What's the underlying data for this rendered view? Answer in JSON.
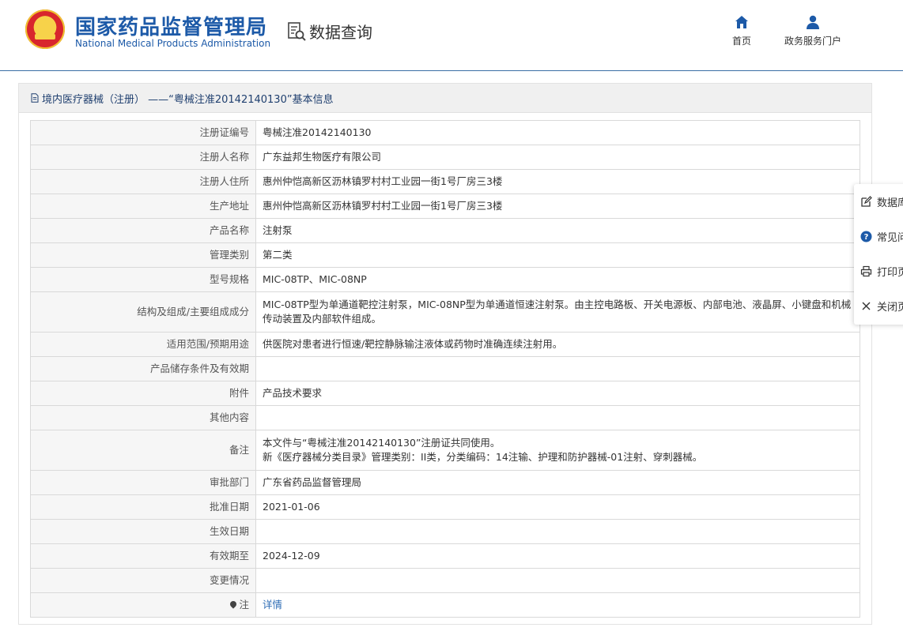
{
  "header": {
    "org_name_cn": "国家药品监督管理局",
    "org_name_en": "National Medical Products Administration",
    "query_title": "数据查询",
    "nav": [
      {
        "label": "首页",
        "icon": "home-icon"
      },
      {
        "label": "政务服务门户",
        "icon": "user-icon"
      }
    ]
  },
  "panel": {
    "title": "境内医疗器械（注册） ——“粤械注准20142140130”基本信息"
  },
  "rows": [
    {
      "label": "注册证编号",
      "value": "粤械注准20142140130"
    },
    {
      "label": "注册人名称",
      "value": "广东益邦生物医疗有限公司"
    },
    {
      "label": "注册人住所",
      "value": "惠州仲恺高新区沥林镇罗村村工业园一街1号厂房三3楼"
    },
    {
      "label": "生产地址",
      "value": "惠州仲恺高新区沥林镇罗村村工业园一街1号厂房三3楼"
    },
    {
      "label": "产品名称",
      "value": "注射泵"
    },
    {
      "label": "管理类别",
      "value": "第二类"
    },
    {
      "label": "型号规格",
      "value": "MIC-08TP、MIC-08NP"
    },
    {
      "label": "结构及组成/主要组成成分",
      "value": "MIC-08TP型为单通道靶控注射泵，MIC-08NP型为单通道恒速注射泵。由主控电路板、开关电源板、内部电池、液晶屏、小键盘和机械传动装置及内部软件组成。"
    },
    {
      "label": "适用范围/预期用途",
      "value": "供医院对患者进行恒速/靶控静脉输注液体或药物时准确连续注射用。"
    },
    {
      "label": "产品储存条件及有效期",
      "value": ""
    },
    {
      "label": "附件",
      "value": "产品技术要求"
    },
    {
      "label": "其他内容",
      "value": ""
    },
    {
      "label": "备注",
      "value_line1": "本文件与“粤械注准20142140130”注册证共同使用。",
      "value_line2": "新《医疗器械分类目录》管理类别：II类，分类编码：14注输、护理和防护器械-01注射、穿刺器械。"
    },
    {
      "label": "审批部门",
      "value": "广东省药品监督管理局"
    },
    {
      "label": "批准日期",
      "value": "2021-01-06"
    },
    {
      "label": "生效日期",
      "value": ""
    },
    {
      "label": "有效期至",
      "value": "2024-12-09"
    },
    {
      "label": "变更情况",
      "value": ""
    },
    {
      "label": "注",
      "value": "详情"
    }
  ],
  "side_panel": [
    {
      "label": "数据库",
      "icon": "edit-icon"
    },
    {
      "label": "常见问",
      "icon": "question-icon"
    },
    {
      "label": "打印页",
      "icon": "printer-icon"
    },
    {
      "label": "关闭页",
      "icon": "close-icon"
    }
  ],
  "colors": {
    "brand_blue": "#1d5aa8",
    "link_blue": "#2d6cb5",
    "label_bg": "#f6f6f6",
    "title_bar_bg": "#f0f0f0"
  }
}
